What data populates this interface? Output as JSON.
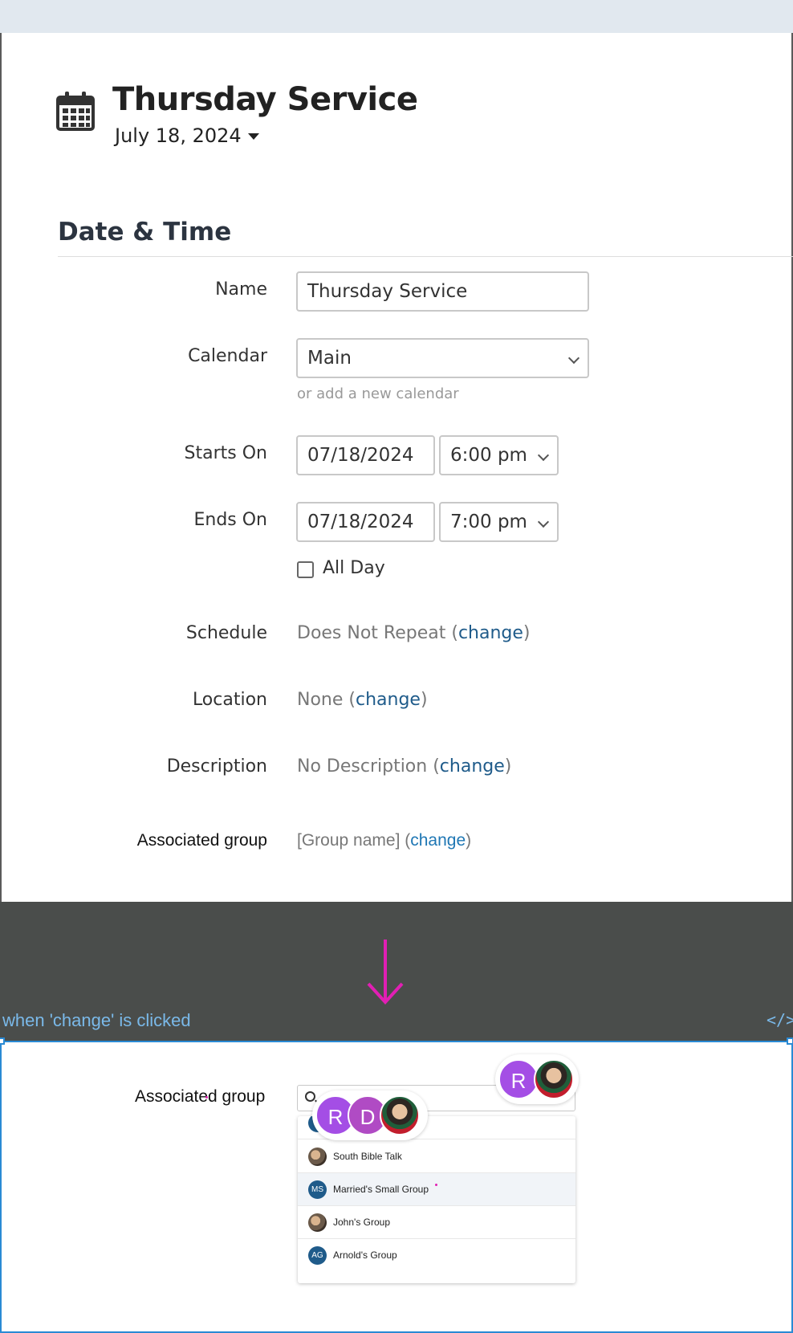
{
  "header": {
    "title": "Thursday Service",
    "date": "July 18, 2024",
    "icons": {
      "calendar": "calendar-icon",
      "date_caret": "caret-down-icon"
    }
  },
  "section": {
    "title": "Date & Time"
  },
  "form": {
    "name": {
      "label": "Name",
      "value": "Thursday Service"
    },
    "calendar": {
      "label": "Calendar",
      "value": "Main",
      "hint": "or add a new calendar"
    },
    "starts_on": {
      "label": "Starts On",
      "date": "07/18/2024",
      "time": "6:00 pm"
    },
    "ends_on": {
      "label": "Ends On",
      "date": "07/18/2024",
      "time": "7:00 pm"
    },
    "all_day": {
      "label": "All Day",
      "checked": false
    },
    "schedule": {
      "label": "Schedule",
      "value": "Does Not Repeat",
      "link": "change"
    },
    "location": {
      "label": "Location",
      "value": "None",
      "link": "change"
    },
    "description": {
      "label": "Description",
      "value": "No Description",
      "link": "change"
    },
    "associated_group": {
      "label": "Associated group",
      "value": "[Group name]",
      "link": "change"
    }
  },
  "annotation": {
    "caption": "when 'change' is clicked",
    "code_toggle": "</>",
    "arrow_color": "#e11fb4",
    "frame_color": "#2a8ad4"
  },
  "expanded": {
    "label": "Associated group",
    "search_placeholder": "",
    "options": [
      {
        "name": "",
        "initials": "",
        "avatar": "initials"
      },
      {
        "name": "South Bible Talk",
        "initials": "",
        "avatar": "photo"
      },
      {
        "name": "Married's Small Group",
        "initials": "MS",
        "avatar": "initials",
        "highlighted": true
      },
      {
        "name": "John's Group",
        "initials": "",
        "avatar": "photo"
      },
      {
        "name": "Arnold's Group",
        "initials": "AG",
        "avatar": "initials"
      }
    ]
  },
  "presence": {
    "group_a": [
      {
        "initial": "R",
        "color": "#a44ee5"
      },
      {
        "initial": "D",
        "color": "#b04bc4"
      },
      {
        "initial": "",
        "color": "photo"
      }
    ],
    "group_b": [
      {
        "initial": "R",
        "color": "#a44ee5"
      },
      {
        "initial": "",
        "color": "photo"
      }
    ]
  }
}
